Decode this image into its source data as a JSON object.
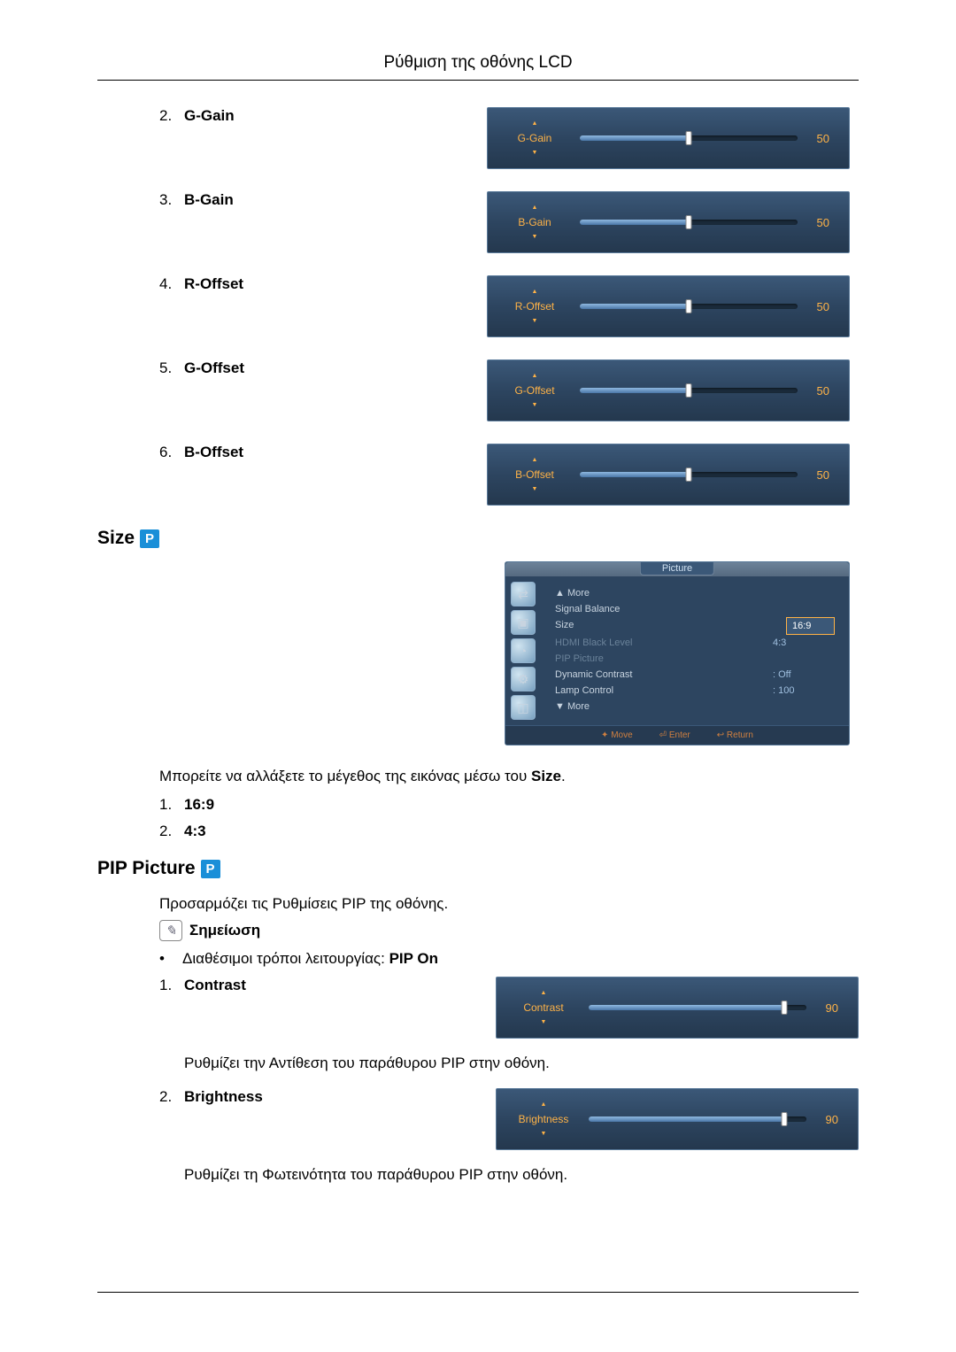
{
  "page_title": "Ρύθμιση της οθόνης LCD",
  "sliders": [
    {
      "idx": "2.",
      "name": "G-Gain",
      "osd_label": "G-Gain",
      "value": 50,
      "percent": 50
    },
    {
      "idx": "3.",
      "name": "B-Gain",
      "osd_label": "B-Gain",
      "value": 50,
      "percent": 50
    },
    {
      "idx": "4.",
      "name": "R-Offset",
      "osd_label": "R-Offset",
      "value": 50,
      "percent": 50
    },
    {
      "idx": "5.",
      "name": "G-Offset",
      "osd_label": "G-Offset",
      "value": 50,
      "percent": 50
    },
    {
      "idx": "6.",
      "name": "B-Offset",
      "osd_label": "B-Offset",
      "value": 50,
      "percent": 50
    }
  ],
  "size_section": {
    "title": "Size",
    "menu_title": "Picture",
    "menu_more_top": "▲ More",
    "menu_items": [
      {
        "label": "Signal Balance",
        "value": ""
      },
      {
        "label": "Size",
        "value": "16:9",
        "selected": true
      },
      {
        "label": "HDMI Black Level",
        "value": "4:3",
        "disabled": true
      },
      {
        "label": "PIP Picture",
        "value": "",
        "disabled": true
      },
      {
        "label": "Dynamic Contrast",
        "value": ": Off"
      },
      {
        "label": "Lamp Control",
        "value": ": 100"
      }
    ],
    "menu_more_bottom": "▼ More",
    "footer": {
      "move": "Move",
      "enter": "Enter",
      "return": "Return"
    },
    "desc": "Μπορείτε να αλλάξετε το μέγεθος της εικόνας μέσω του ",
    "desc_bold": "Size",
    "list": [
      {
        "idx": "1.",
        "label": "16:9"
      },
      {
        "idx": "2.",
        "label": "4:3"
      }
    ]
  },
  "pip_section": {
    "title": "PIP Picture",
    "desc": "Προσαρμόζει τις Ρυθμίσεις PIP της οθόνης.",
    "note_label": "Σημείωση",
    "bullet_text": "Διαθέσιμοι τρόποι λειτουργίας: ",
    "bullet_bold": "PIP On",
    "items": [
      {
        "idx": "1.",
        "name": "Contrast",
        "osd_label": "Contrast",
        "value": 90,
        "percent": 90,
        "after_text": "Ρυθμίζει την Αντίθεση του παράθυρου PIP στην οθόνη."
      },
      {
        "idx": "2.",
        "name": "Brightness",
        "osd_label": "Brightness",
        "value": 90,
        "percent": 90,
        "after_text": "Ρυθμίζει τη Φωτεινότητα του παράθυρου PIP στην οθόνη."
      }
    ]
  }
}
